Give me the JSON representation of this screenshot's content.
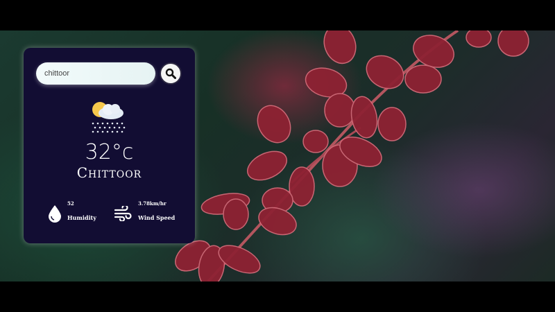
{
  "weather_card": {
    "search": {
      "value": "chittoor",
      "placeholder": ""
    },
    "search_button_icon": "magnifier-icon",
    "condition_icon": "partly-cloudy-snow-icon",
    "temperature": "32°c",
    "city": "Chittoor",
    "humidity": {
      "value": "52",
      "label": "Humidity",
      "icon": "water-drop-icon"
    },
    "wind": {
      "value": "3.78km/hr",
      "label": "Wind Speed",
      "icon": "wind-icon"
    }
  },
  "colors": {
    "card_background": "#120d33",
    "page_letterbox": "#000000",
    "leaf_color": "#8e2233"
  }
}
